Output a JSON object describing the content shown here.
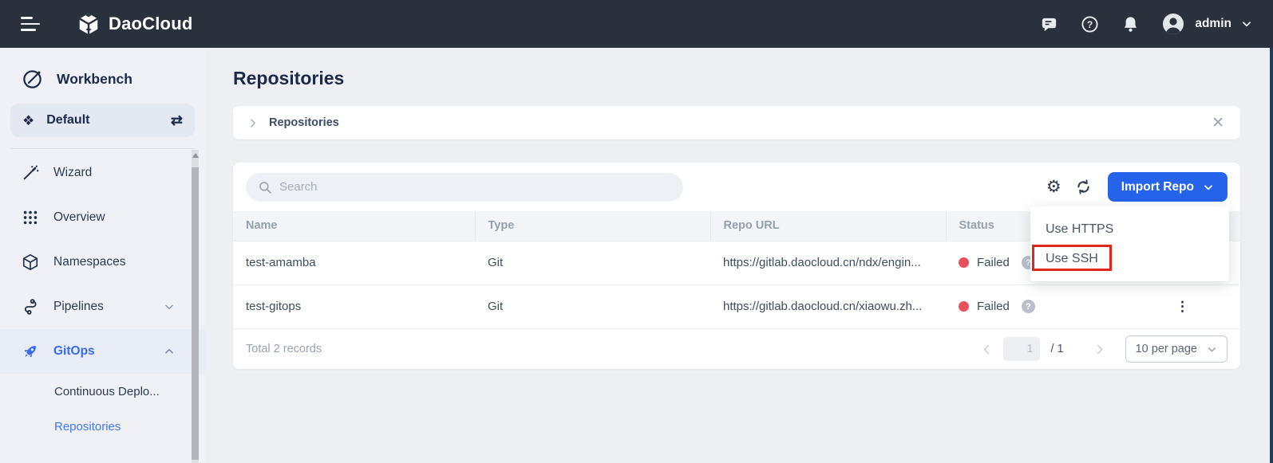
{
  "topbar": {
    "brand": "DaoCloud",
    "username": "admin",
    "icons": [
      "menu-icon",
      "message-icon",
      "help-icon",
      "bell-icon",
      "avatar-icon",
      "chevron-down-icon"
    ]
  },
  "sidebar": {
    "module_label": "Workbench",
    "workspace_label": "Default",
    "items": [
      {
        "label": "Wizard",
        "icon": "wand-icon"
      },
      {
        "label": "Overview",
        "icon": "grid-dots-icon"
      },
      {
        "label": "Namespaces",
        "icon": "cube-icon"
      },
      {
        "label": "Pipelines",
        "icon": "pipeline-icon",
        "chevron": "down"
      },
      {
        "label": "GitOps",
        "icon": "rocket-icon",
        "chevron": "up",
        "active": true
      }
    ],
    "subitems": [
      {
        "label": "Continuous Deplo..."
      },
      {
        "label": "Repositories",
        "active": true
      }
    ]
  },
  "page": {
    "title": "Repositories",
    "breadcrumb": "Repositories"
  },
  "toolbar": {
    "search_placeholder": "Search",
    "import_button": "Import Repo"
  },
  "dropdown": {
    "items": [
      "Use HTTPS",
      "Use SSH"
    ],
    "highlighted": "Use SSH"
  },
  "table": {
    "columns": [
      "Name",
      "Type",
      "Repo URL",
      "Status",
      ""
    ],
    "rows": [
      {
        "name": "test-amamba",
        "type": "Git",
        "repo_url": "https://gitlab.daocloud.cn/ndx/engin...",
        "status": "Failed"
      },
      {
        "name": "test-gitops",
        "type": "Git",
        "repo_url": "https://gitlab.daocloud.cn/xiaowu.zh...",
        "status": "Failed"
      }
    ]
  },
  "pagination": {
    "total": "Total 2 records",
    "current_page": "1",
    "page_count": "/ 1",
    "per_page": "10 per page"
  },
  "colors": {
    "topbar_bg": "#2b313c",
    "accent_blue": "#2563eb",
    "link_blue": "#4277f5",
    "failed_red": "#e8505b",
    "annotation_red": "#e1271c"
  }
}
